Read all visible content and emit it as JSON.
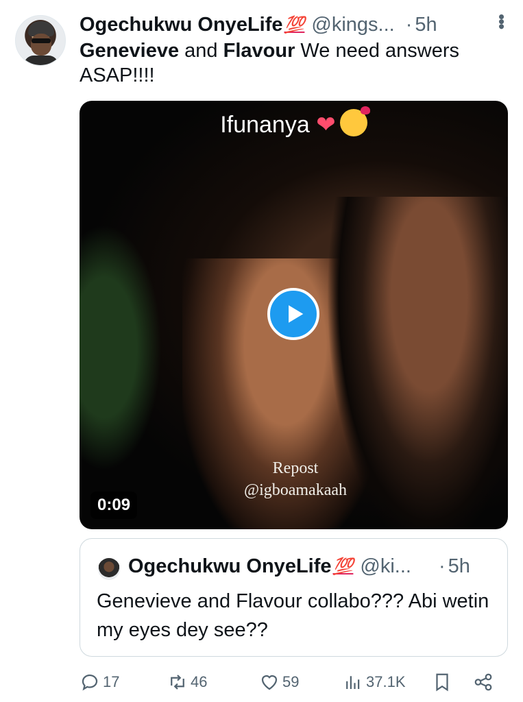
{
  "tweet": {
    "author_name": "Ogechukwu OnyeLife",
    "author_emoji": "💯",
    "handle": "@kings...",
    "separator": "·",
    "time": "5h",
    "text_bold_1": "Genevieve",
    "text_and": " and ",
    "text_bold_2": "Flavour",
    "text_rest": " We need answers ASAP!!!!"
  },
  "media": {
    "caption": "Ifunanya",
    "watermark_line1": "Repost",
    "watermark_line2": "@igboamakaah",
    "duration": "0:09"
  },
  "quote": {
    "author_name": "Ogechukwu OnyeLife",
    "author_emoji": "💯",
    "handle": "@ki...",
    "separator": "·",
    "time": "5h",
    "text": "Genevieve and Flavour collabo??? Abi wetin my eyes dey see??"
  },
  "actions": {
    "replies": "17",
    "reposts": "46",
    "likes": "59",
    "views": "37.1K"
  },
  "colors": {
    "accent": "#1d9bf0",
    "secondary_text": "#536471",
    "primary_text": "#0f1419",
    "border": "#cfd9de"
  },
  "icons": [
    "reply-icon",
    "repost-icon",
    "like-icon",
    "views-icon",
    "bookmark-icon",
    "share-icon",
    "more-icon",
    "play-icon"
  ]
}
